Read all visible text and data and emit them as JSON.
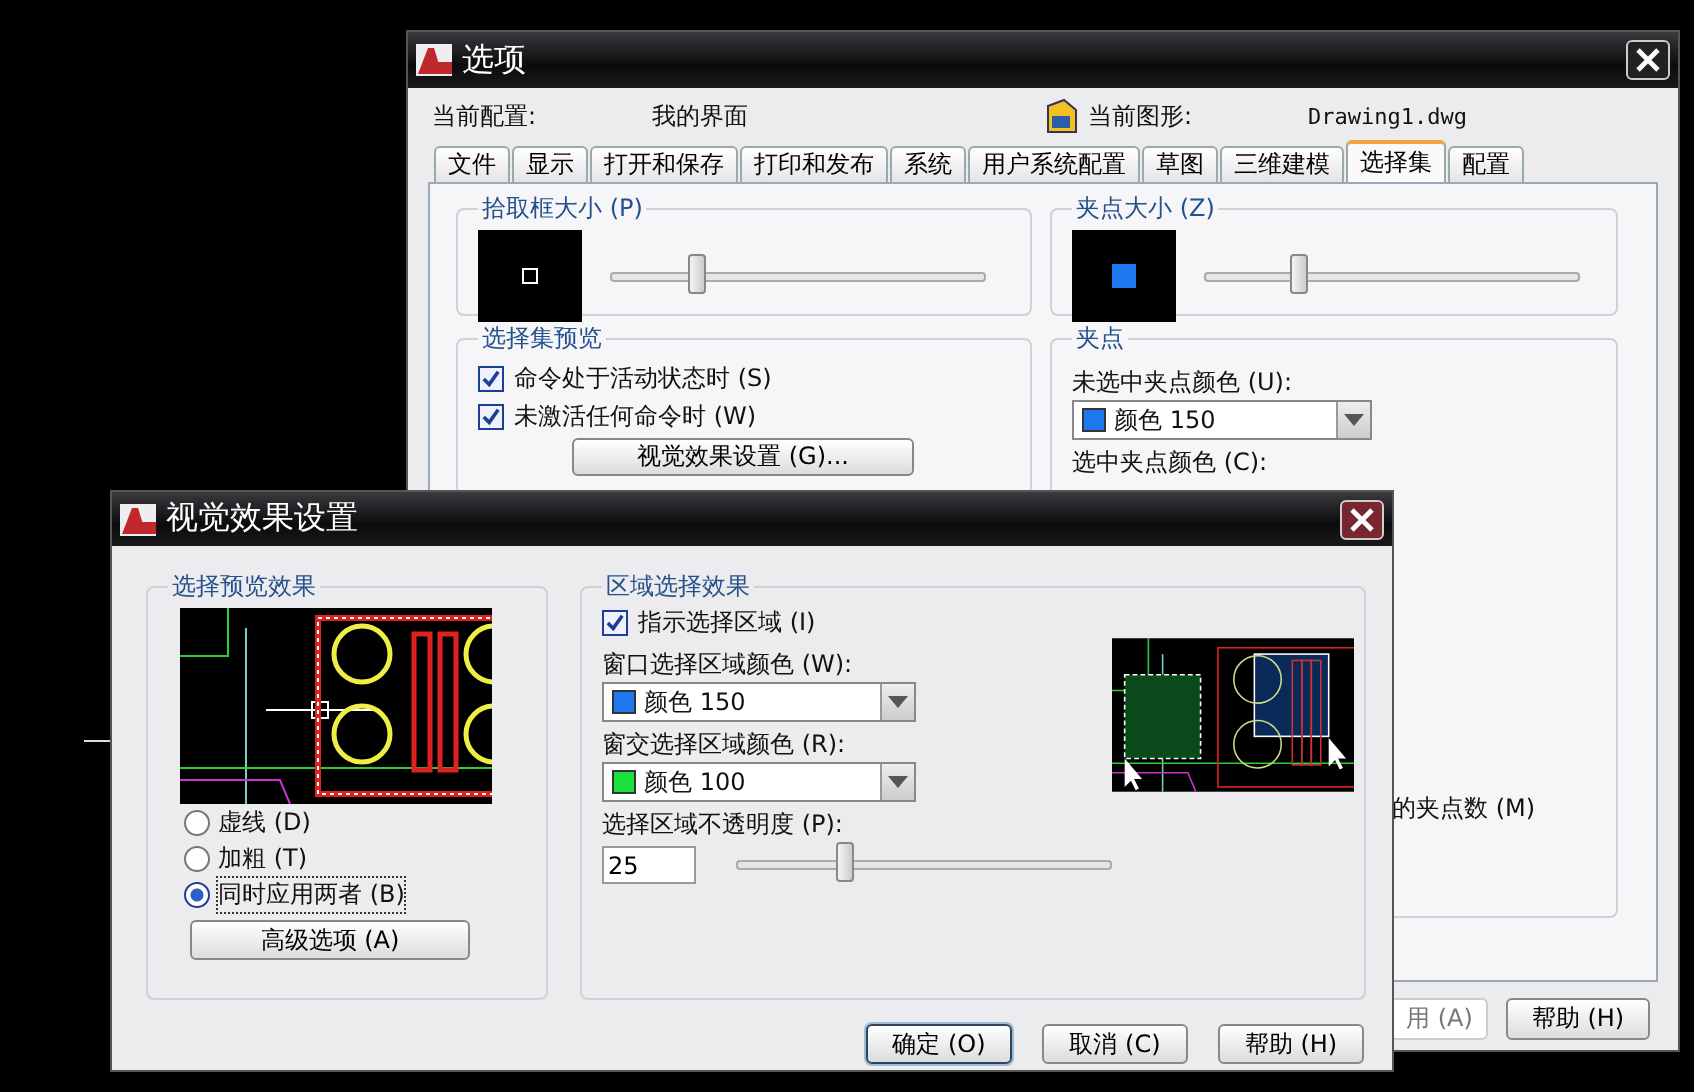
{
  "options_window": {
    "title": "选项",
    "current_profile_label": "当前配置:",
    "current_profile": "我的界面",
    "current_drawing_label": "当前图形:",
    "current_drawing": "Drawing1.dwg",
    "tabs": [
      {
        "label": "文件",
        "selected": false
      },
      {
        "label": "显示",
        "selected": false
      },
      {
        "label": "打开和保存",
        "selected": false
      },
      {
        "label": "打印和发布",
        "selected": false
      },
      {
        "label": "系统",
        "selected": false
      },
      {
        "label": "用户系统配置",
        "selected": false
      },
      {
        "label": "草图",
        "selected": false
      },
      {
        "label": "三维建模",
        "selected": false
      },
      {
        "label": "选择集",
        "selected": true
      },
      {
        "label": "配置",
        "selected": false
      }
    ],
    "pickbox": {
      "title": "拾取框大小 (P)",
      "level": 0.21
    },
    "grip_size": {
      "title": "夹点大小 (Z)",
      "level": 0.23
    },
    "preview": {
      "title": "选择集预览",
      "options": [
        {
          "label": "命令处于活动状态时 (S)",
          "checked": true
        },
        {
          "label": "未激活任何命令时 (W)",
          "checked": true
        }
      ],
      "button": "视觉效果设置 (G)..."
    },
    "grips": {
      "title": "夹点",
      "unselected_label": "未选中夹点颜色 (U):",
      "unselected_value": {
        "label": "颜色 150",
        "color": "#1e78f0"
      },
      "selected_label": "选中夹点颜色 (C):",
      "grip_limit_label": "的夹点数 (M)"
    },
    "buttons": [
      {
        "label": "用 (A)",
        "disabled": true
      },
      {
        "label": "帮助 (H)",
        "disabled": false
      }
    ]
  },
  "visual_dialog": {
    "title": "视觉效果设置",
    "preview_group": {
      "title": "选择预览效果",
      "options": [
        {
          "label": "虚线 (D)",
          "selected": false
        },
        {
          "label": "加粗 (T)",
          "selected": false
        },
        {
          "label": "同时应用两者 (B)",
          "selected": true
        }
      ],
      "button": "高级选项 (A)"
    },
    "area_group": {
      "title": "区域选择效果",
      "indicate": {
        "label": "指示选择区域 (I)",
        "checked": true
      },
      "colors": [
        {
          "label": "窗口选择区域颜色 (W):",
          "value": "颜色 150",
          "color": "#1e78f0"
        },
        {
          "label": "窗交选择区域颜色 (R):",
          "value": "颜色 100",
          "color": "#19e03c"
        }
      ],
      "opacity_label": "选择区域不透明度 (P):",
      "opacity_value": "25",
      "level": 0.27
    },
    "buttons": [
      {
        "label": "确定 (O)",
        "default": true
      },
      {
        "label": "取消 (C)",
        "default": false
      },
      {
        "label": "帮助 (H)",
        "default": false
      }
    ]
  }
}
